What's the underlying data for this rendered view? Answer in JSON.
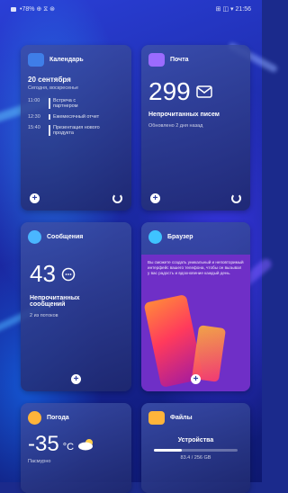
{
  "status_bar": {
    "left": "•78% ⊕ ⧖ ⊛",
    "right": "⊞ ◫ ▾ 21:56"
  },
  "calendar": {
    "title": "Календарь",
    "date": "20 сентября",
    "subtitle": "Сегодня, воскресенье",
    "events": [
      {
        "time": "11:00",
        "text": "Встреча с партнером"
      },
      {
        "time": "12:30",
        "text": "Ежемесячный отчет"
      },
      {
        "time": "15:40",
        "text": "Презентация нового продукта"
      }
    ]
  },
  "mail": {
    "title": "Почта",
    "count": "299",
    "label": "Непрочитанных писем",
    "status": "Обновлено 2 дня назад"
  },
  "messages": {
    "title": "Сообщения",
    "count": "43",
    "label": "Непрочитанных сообщений",
    "sub": "2 из потоков"
  },
  "browser": {
    "title": "Браузер",
    "text": "Вы сможете создать уникальный и неповторимый интерфейс вашего телефона, чтобы он вызывал у вас радость и вдохновение каждый день."
  },
  "weather": {
    "title": "Погода",
    "temp": "-35",
    "unit": "°C",
    "desc": "Пасмурно"
  },
  "files": {
    "title": "Файлы",
    "device_label": "Устройства",
    "storage": "83.4 / 256 GB",
    "usage": 0.33
  },
  "colors": {
    "calendar_icon": "#3f7ee8",
    "mail_icon": "#9b6bff",
    "messages_icon": "#4ab6ff",
    "browser_icon": "#3fc3ff",
    "browser_panel": "#6f2fc7",
    "weather_icon": "#ffb43a",
    "files_icon": "#ffb43a"
  }
}
